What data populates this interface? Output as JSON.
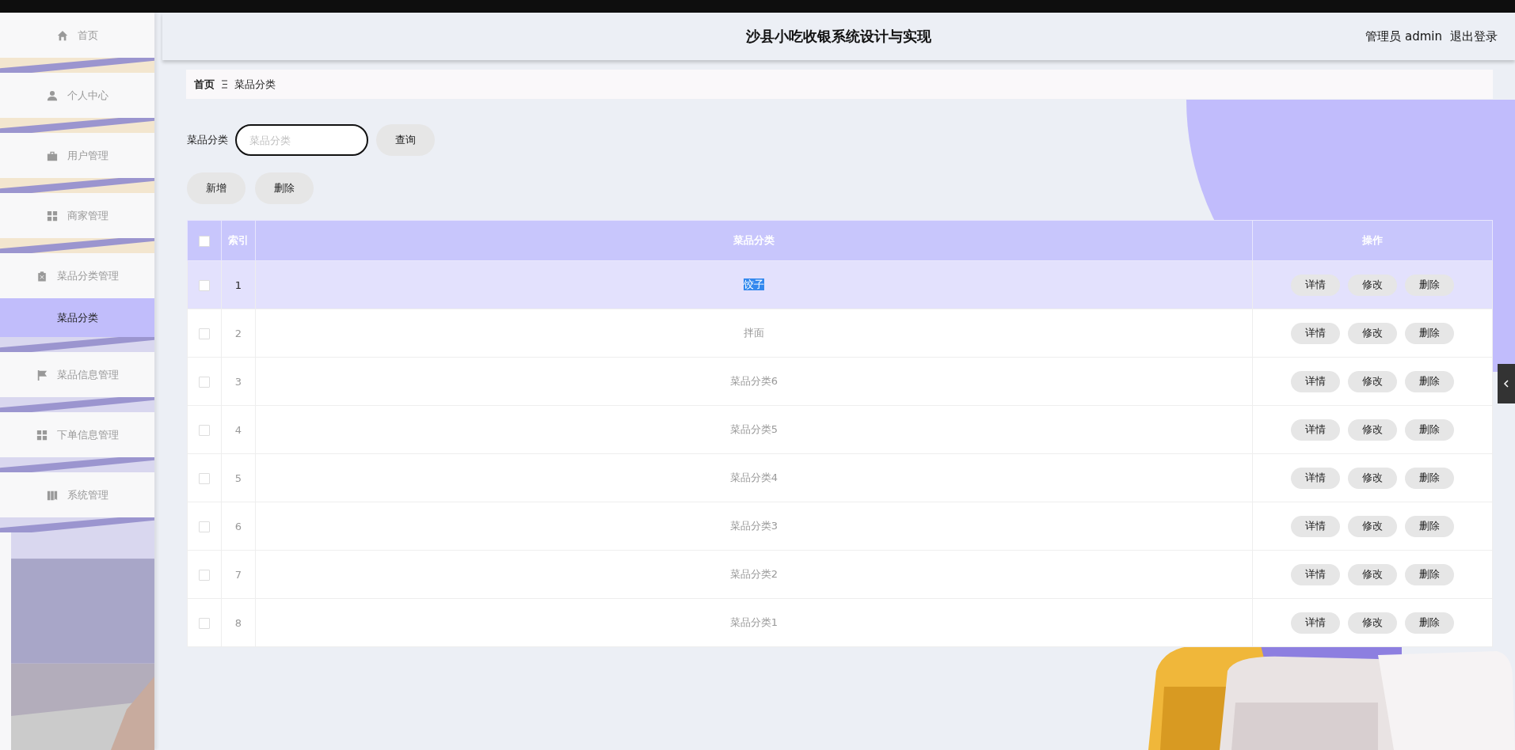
{
  "header": {
    "title": "沙县小吃收银系统设计与实现",
    "user": "管理员 admin",
    "logout": "退出登录"
  },
  "sidebar": {
    "items": [
      {
        "label": "首页",
        "kind": "home",
        "selected": false
      },
      {
        "label": "个人中心",
        "kind": "user",
        "selected": false
      },
      {
        "label": "用户管理",
        "kind": "briefcase",
        "selected": false
      },
      {
        "label": "商家管理",
        "kind": "grid",
        "selected": false
      },
      {
        "label": "菜品分类管理",
        "kind": "clipboard",
        "selected": false,
        "children": [
          {
            "label": "菜品分类",
            "selected": true
          }
        ]
      },
      {
        "label": "菜品信息管理",
        "kind": "flag",
        "selected": false
      },
      {
        "label": "下单信息管理",
        "kind": "grid",
        "selected": false
      },
      {
        "label": "系统管理",
        "kind": "book",
        "selected": false
      }
    ]
  },
  "breadcrumb": [
    "首页",
    "菜品分类"
  ],
  "search": {
    "label": "菜品分类",
    "placeholder": "菜品分类",
    "button": "查询"
  },
  "actions": [
    "新增",
    "删除"
  ],
  "table": {
    "all_checked": false,
    "columns": [
      "索引",
      "菜品分类",
      "操作"
    ],
    "rows": [
      {
        "index": "1",
        "name": "饺子",
        "checked": false,
        "hovered": true,
        "name_highlighted": true,
        "actions": [
          "详情",
          "修改",
          "删除"
        ]
      },
      {
        "index": "2",
        "name": "拌面",
        "checked": false,
        "hovered": false,
        "name_highlighted": false,
        "actions": [
          "详情",
          "修改",
          "删除"
        ]
      },
      {
        "index": "3",
        "name": "菜品分类6",
        "checked": false,
        "hovered": false,
        "name_highlighted": false,
        "actions": [
          "详情",
          "修改",
          "删除"
        ]
      },
      {
        "index": "4",
        "name": "菜品分类5",
        "checked": false,
        "hovered": false,
        "name_highlighted": false,
        "actions": [
          "详情",
          "修改",
          "删除"
        ]
      },
      {
        "index": "5",
        "name": "菜品分类4",
        "checked": false,
        "hovered": false,
        "name_highlighted": false,
        "actions": [
          "详情",
          "修改",
          "删除"
        ]
      },
      {
        "index": "6",
        "name": "菜品分类3",
        "checked": false,
        "hovered": false,
        "name_highlighted": false,
        "actions": [
          "详情",
          "修改",
          "删除"
        ]
      },
      {
        "index": "7",
        "name": "菜品分类2",
        "checked": false,
        "hovered": false,
        "name_highlighted": false,
        "actions": [
          "详情",
          "修改",
          "删除"
        ]
      },
      {
        "index": "8",
        "name": "菜品分类1",
        "checked": false,
        "hovered": false,
        "name_highlighted": false,
        "actions": [
          "详情",
          "修改",
          "删除"
        ]
      }
    ]
  }
}
